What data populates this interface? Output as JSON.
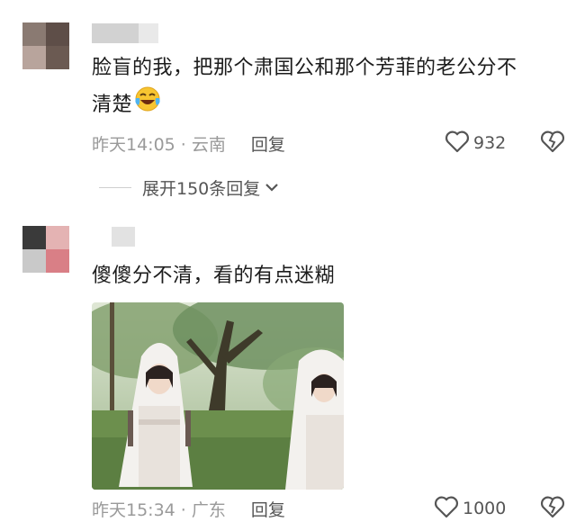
{
  "comments": [
    {
      "text_line1": "脸盲的我，把那个肃国公和那个芳菲的老公分不",
      "text_line2": "清楚",
      "emoji": "laughing-crying-emoji",
      "timestamp": "昨天14:05",
      "location": "· 云南",
      "reply_label": "回复",
      "likes": "932",
      "expand_label": "展开150条回复"
    },
    {
      "text_line1": "傻傻分不清，看的有点迷糊",
      "timestamp": "昨天15:34",
      "location": "· 广东",
      "reply_label": "回复",
      "likes": "1000"
    }
  ],
  "icons": {
    "like": "heart-outline-icon",
    "dislike": "broken-heart-icon",
    "expand": "chevron-down-icon"
  },
  "colors": {
    "text": "#1c1c1c",
    "meta": "#9a9a9a",
    "action": "#555555"
  }
}
